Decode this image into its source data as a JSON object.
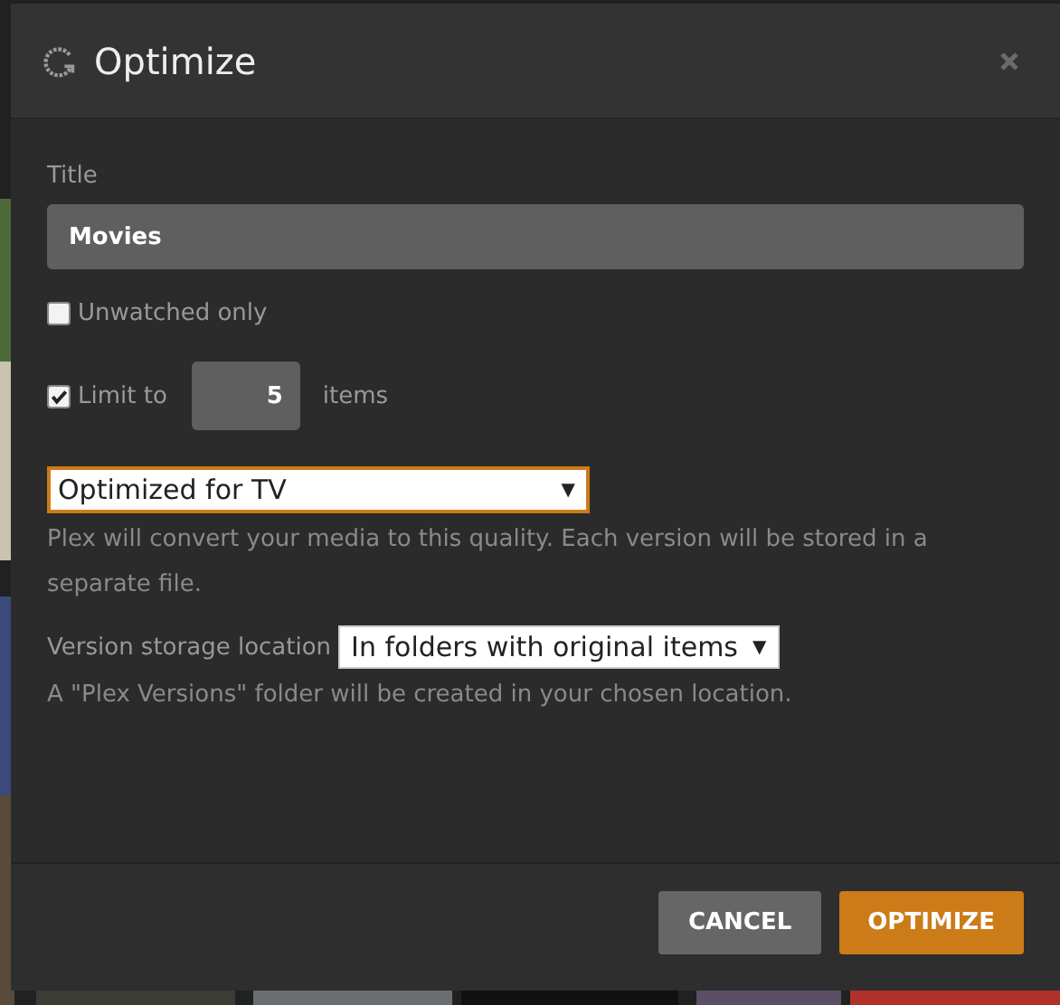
{
  "dialog": {
    "title": "Optimize"
  },
  "title_field": {
    "label": "Title",
    "value": "Movies"
  },
  "unwatched_only": {
    "label": "Unwatched only",
    "checked": false
  },
  "limit": {
    "label": "Limit to",
    "checked": true,
    "value": "5",
    "unit": "items"
  },
  "quality": {
    "value": "Optimized for TV",
    "caret": "▼",
    "help": "Plex will convert your media to this quality. Each version will be stored in a separate file."
  },
  "storage": {
    "label": "Version storage location",
    "value": "In folders with original items",
    "caret": "▼",
    "help": "A \"Plex Versions\" folder will be created in your chosen location."
  },
  "buttons": [
    {
      "label": "CANCEL",
      "kind": "secondary"
    },
    {
      "label": "OPTIMIZE",
      "kind": "primary"
    }
  ]
}
